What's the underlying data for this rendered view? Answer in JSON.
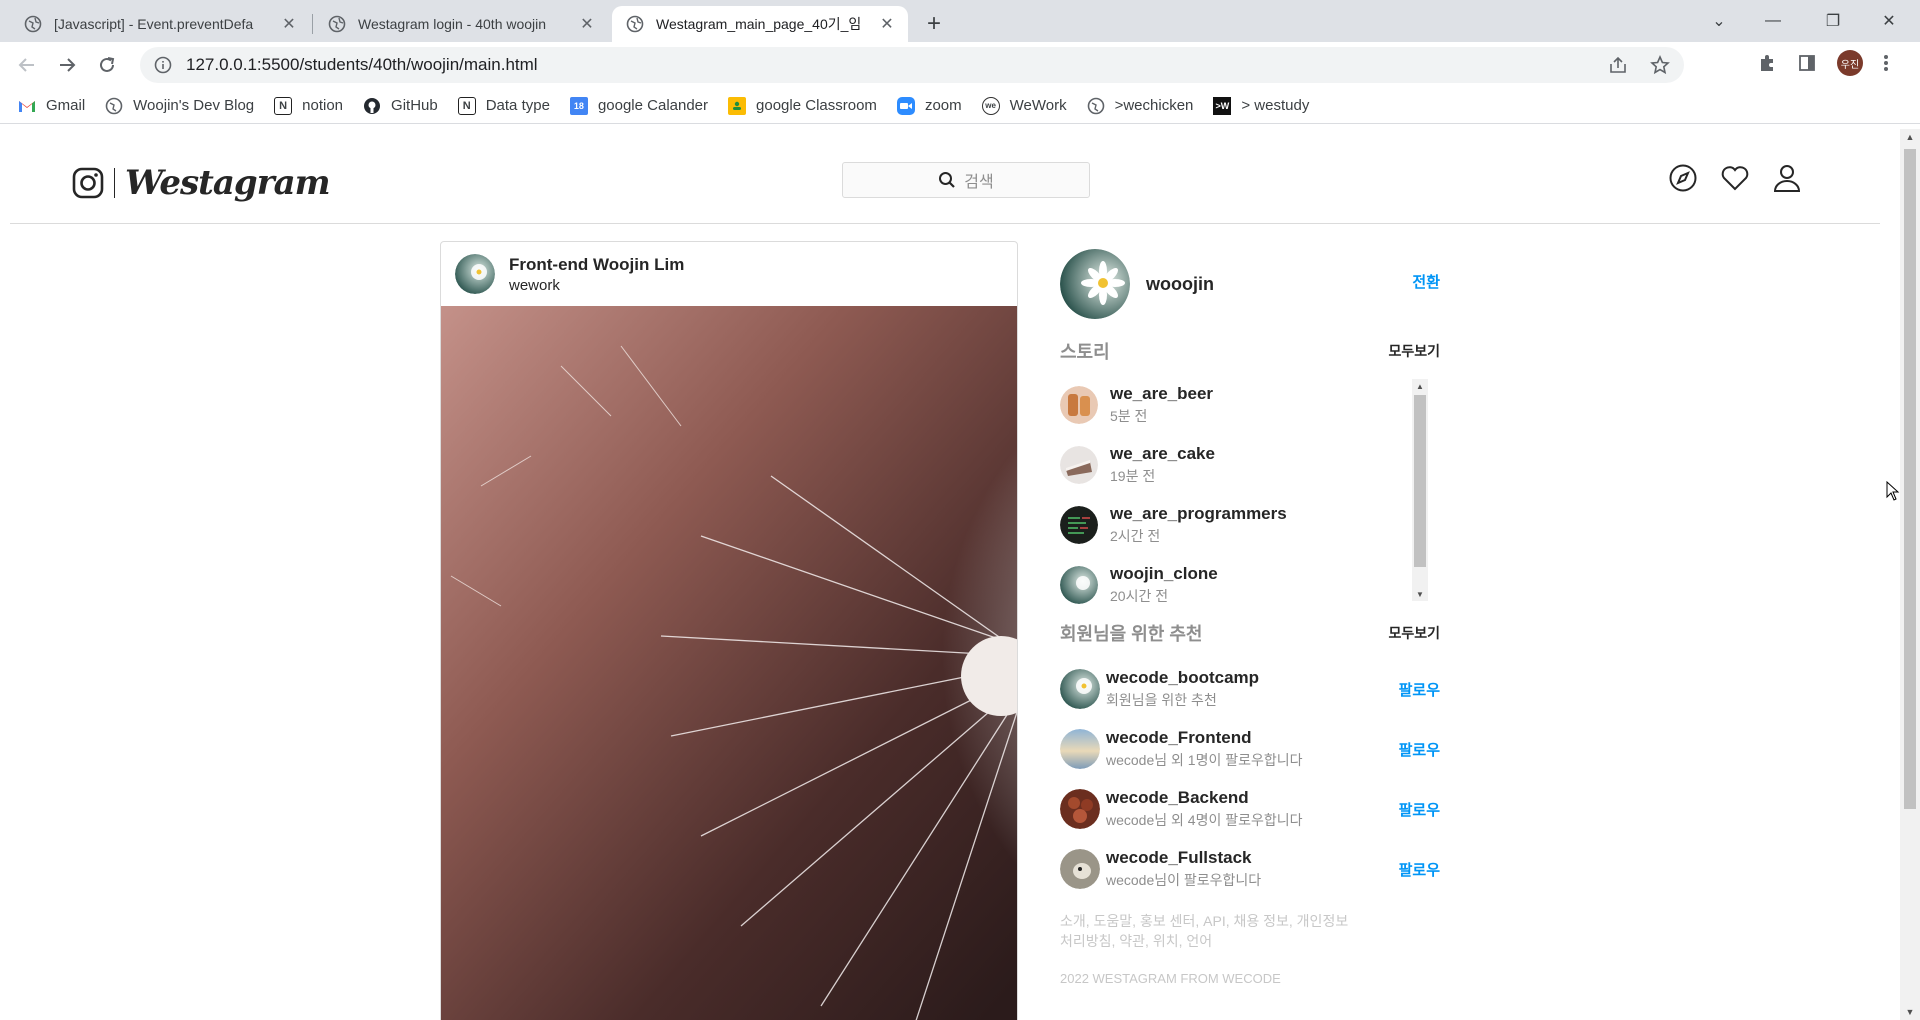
{
  "browser": {
    "tabs": [
      {
        "title": "[Javascript] - Event.preventDefa",
        "active": false
      },
      {
        "title": "Westagram login - 40th woojin",
        "active": false
      },
      {
        "title": "Westagram_main_page_40기_임",
        "active": true
      }
    ],
    "url": "127.0.0.1:5500/students/40th/woojin/main.html",
    "profile_initials": "우진",
    "bookmarks": [
      {
        "label": "Gmail",
        "icon": "gmail-icon"
      },
      {
        "label": "Woojin's Dev Blog",
        "icon": "globe-icon"
      },
      {
        "label": "notion",
        "icon": "notion-icon"
      },
      {
        "label": "GitHub",
        "icon": "github-icon"
      },
      {
        "label": "Data type",
        "icon": "notion-icon"
      },
      {
        "label": "google Calander",
        "icon": "calendar-icon"
      },
      {
        "label": "google Classroom",
        "icon": "classroom-icon"
      },
      {
        "label": "zoom",
        "icon": "zoom-icon"
      },
      {
        "label": "WeWork",
        "icon": "wework-icon"
      },
      {
        "label": ">wechicken",
        "icon": "globe-icon"
      },
      {
        "label": "> westudy",
        "icon": "westudy-icon"
      }
    ]
  },
  "page": {
    "brand": "Westagram",
    "search_placeholder": "검색",
    "feed": {
      "author": "Front-end Woojin Lim",
      "location": "wework"
    },
    "me": {
      "username": "wooojin",
      "switch_label": "전환"
    },
    "stories": {
      "title": "스토리",
      "see_all": "모두보기",
      "items": [
        {
          "name": "we_are_beer",
          "time": "5분 전"
        },
        {
          "name": "we_are_cake",
          "time": "19분 전"
        },
        {
          "name": "we_are_programmers",
          "time": "2시간 전"
        },
        {
          "name": "woojin_clone",
          "time": "20시간 전"
        }
      ]
    },
    "recommend": {
      "title": "회원님을 위한 추천",
      "see_all": "모두보기",
      "items": [
        {
          "name": "wecode_bootcamp",
          "sub": "회원님을 위한 추천",
          "action": "팔로우"
        },
        {
          "name": "wecode_Frontend",
          "sub": "wecode님 외 1명이 팔로우합니다",
          "action": "팔로우"
        },
        {
          "name": "wecode_Backend",
          "sub": "wecode님 외 4명이 팔로우합니다",
          "action": "팔로우"
        },
        {
          "name": "wecode_Fullstack",
          "sub": "wecode님이 팔로우합니다",
          "action": "팔로우"
        }
      ]
    },
    "footer_links": "소개, 도움말, 홍보 센터, API, 채용 정보, 개인정보처리방침, 약관, 위치, 언어",
    "copyright": "2022 WESTAGRAM FROM WECODE"
  }
}
